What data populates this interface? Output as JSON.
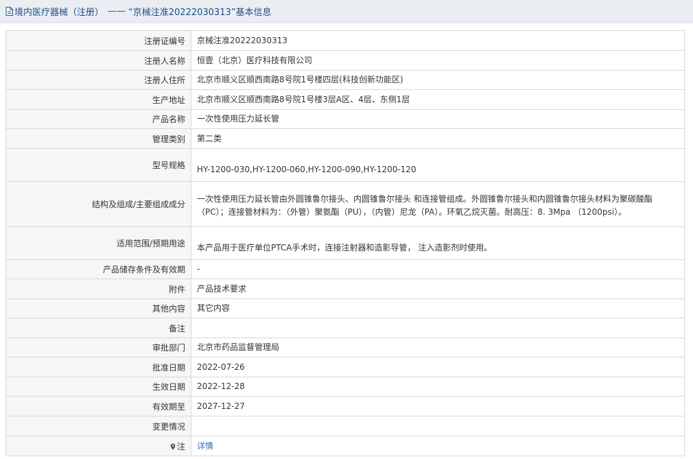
{
  "header": {
    "section_label": "境内医疗器械（注册）",
    "separator": "——",
    "record_title": "“京械注准20222030313”基本信息",
    "icon": "document-icon"
  },
  "rows": [
    {
      "label": "注册证编号",
      "value": "京械注准20222030313"
    },
    {
      "label": "注册人名称",
      "value": "恒壹（北京）医疗科技有限公司"
    },
    {
      "label": "注册人住所",
      "value": "北京市顺义区顺西南路8号院1号楼四层(科技创新功能区)"
    },
    {
      "label": "生产地址",
      "value": "北京市顺义区顺西南路8号院1号楼3层A区、4层、东侧1层"
    },
    {
      "label": "产品名称",
      "value": "一次性使用压力延长管"
    },
    {
      "label": "管理类别",
      "value": "第二类"
    },
    {
      "label": "型号规格",
      "value": "HY-1200-030,HY-1200-060,HY-1200-090,HY-1200-120"
    },
    {
      "label": "结构及组成/主要组成成分",
      "value": "一次性使用压力延长管由外圆锥鲁尔接头、内圆锥鲁尔接头 和连接管组成。外圆锥鲁尔接头和内圆锥鲁尔接头材料为聚碳酸酯（PC）；连接管材料为：（外管）聚氨酯（PU），（内管）尼龙（PA）。环氧乙烷灭菌。耐高压：8. 3Mpa （1200psi）。"
    },
    {
      "label": "适用范围/预期用途",
      "value": "本产品用于医疗单位PTCA手术时，连接注射器和造影导管， 注入造影剂时使用。"
    },
    {
      "label": "产品储存条件及有效期",
      "value": "-"
    },
    {
      "label": "附件",
      "value": "产品技术要求"
    },
    {
      "label": "其他内容",
      "value": "其它内容"
    },
    {
      "label": "备注",
      "value": ""
    },
    {
      "label": "审批部门",
      "value": "北京市药品监督管理局"
    },
    {
      "label": "批准日期",
      "value": "2022-07-26"
    },
    {
      "label": "生效日期",
      "value": "2022-12-28"
    },
    {
      "label": "有效期至",
      "value": "2027-12-27"
    },
    {
      "label": "变更情况",
      "value": ""
    },
    {
      "label": "注",
      "value": "详情",
      "icon": "location-pin-icon"
    }
  ]
}
